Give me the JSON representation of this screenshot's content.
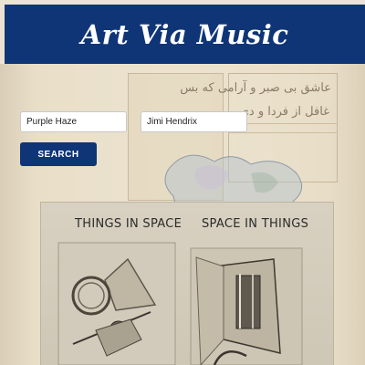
{
  "header": {
    "title": "Art Via Music"
  },
  "search": {
    "song_value": "Purple Haze",
    "artist_value": "Jimi Hendrix",
    "button_label": "SEARCH"
  },
  "background": {
    "manuscript_text_lines": [
      "عاشق بی صبر و آرامی که بس",
      "غافل از فردا و دی"
    ]
  },
  "artwork": {
    "left_caption": "THINGS IN SPACE",
    "right_caption": "SPACE IN THINGS"
  },
  "colors": {
    "header_bg": "#0f3577",
    "button_bg": "#0f3577",
    "header_text": "#ffffff"
  }
}
